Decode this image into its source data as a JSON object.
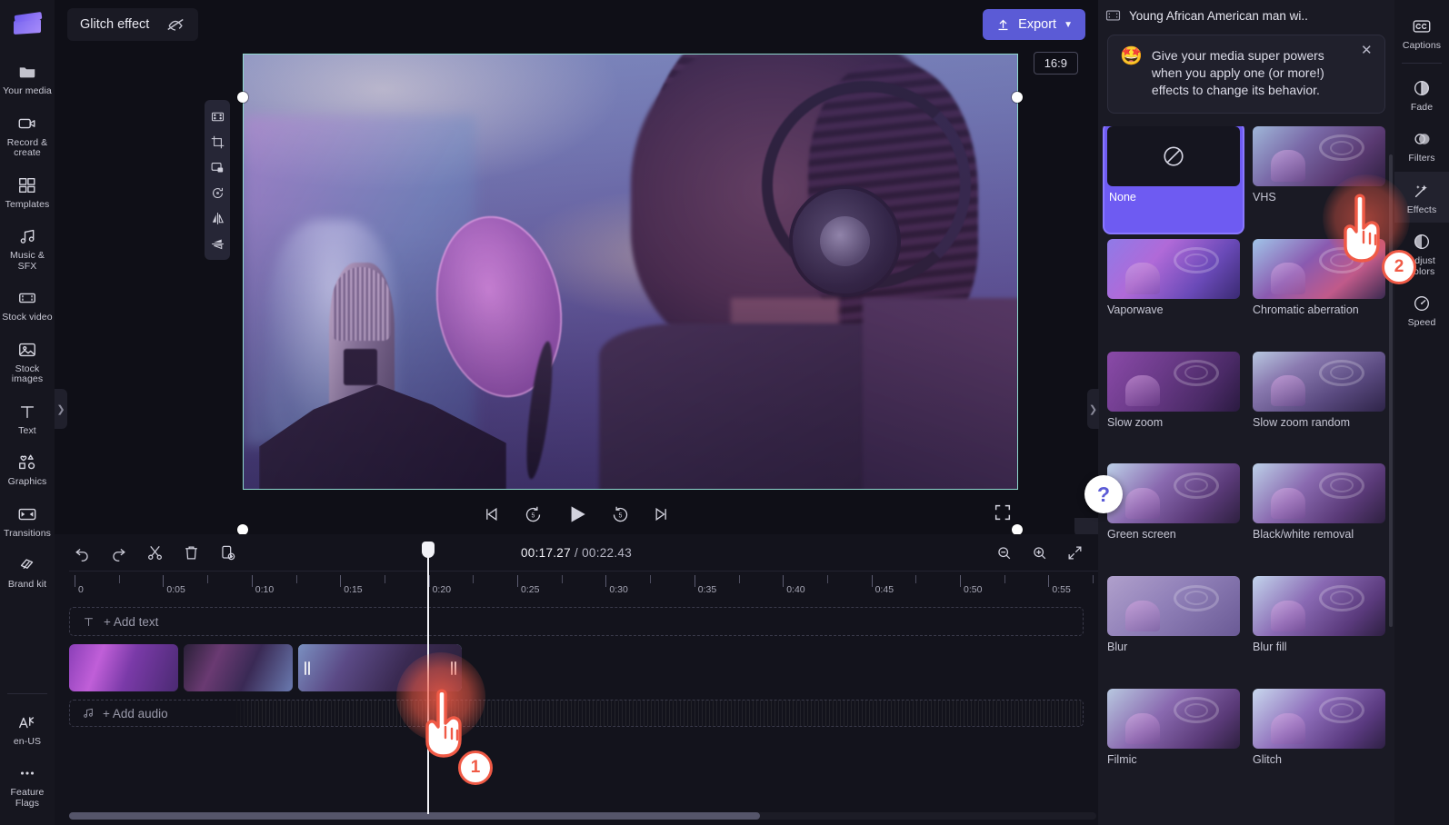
{
  "app": {
    "project_name": "Glitch effect",
    "export_label": "Export",
    "ratio_badge": "16:9"
  },
  "left_rail": {
    "items": [
      {
        "label": "Your media",
        "icon": "media-folder-icon"
      },
      {
        "label": "Record &\ncreate",
        "icon": "video-camera-icon"
      },
      {
        "label": "Templates",
        "icon": "templates-icon"
      },
      {
        "label": "Music & SFX",
        "icon": "music-note-icon"
      },
      {
        "label": "Stock video",
        "icon": "film-strip-icon"
      },
      {
        "label": "Stock\nimages",
        "icon": "image-icon"
      },
      {
        "label": "Text",
        "icon": "text-t-icon"
      },
      {
        "label": "Graphics",
        "icon": "shapes-icon"
      },
      {
        "label": "Transitions",
        "icon": "transitions-icon"
      },
      {
        "label": "Brand kit",
        "icon": "brand-kit-icon"
      }
    ],
    "bottom_items": [
      {
        "label": "en-US",
        "icon": "language-icon"
      },
      {
        "label": "Feature\nFlags",
        "icon": "ellipsis-icon"
      }
    ]
  },
  "stage_tools": [
    {
      "name": "fit-to-frame-icon"
    },
    {
      "name": "crop-icon"
    },
    {
      "name": "picture-in-picture-icon"
    },
    {
      "name": "rotate-icon"
    },
    {
      "name": "flip-horizontal-icon"
    },
    {
      "name": "flip-vertical-icon"
    }
  ],
  "playback": {
    "buttons": [
      {
        "name": "skip-to-start-button",
        "icon": "skip-start-icon"
      },
      {
        "name": "rewind-5-button",
        "icon": "rewind-5-icon"
      },
      {
        "name": "play-button",
        "icon": "play-icon"
      },
      {
        "name": "forward-5-button",
        "icon": "forward-5-icon"
      },
      {
        "name": "skip-to-end-button",
        "icon": "skip-end-icon"
      }
    ],
    "fullscreen": "fullscreen-icon",
    "help_glyph": "?"
  },
  "timeline": {
    "current_time": "00:17.27",
    "separator": " / ",
    "total_time": "00:22.43",
    "tools": [
      {
        "name": "undo-button",
        "icon": "undo-icon"
      },
      {
        "name": "redo-button",
        "icon": "redo-icon"
      },
      {
        "name": "split-button",
        "icon": "scissors-icon"
      },
      {
        "name": "delete-button",
        "icon": "trash-icon"
      },
      {
        "name": "duplicate-button",
        "icon": "duplicate-icon"
      }
    ],
    "right_tools": [
      {
        "name": "zoom-out-button",
        "icon": "zoom-out-icon"
      },
      {
        "name": "zoom-in-button",
        "icon": "zoom-in-icon"
      },
      {
        "name": "fit-timeline-button",
        "icon": "fit-icon"
      }
    ],
    "ruler_labels": [
      "0",
      "0:05",
      "0:10",
      "0:15",
      "0:20",
      "0:25",
      "0:30",
      "0:35",
      "0:40",
      "0:45",
      "0:50",
      "0:55"
    ],
    "add_text_label": "+ Add text",
    "add_audio_label": "+ Add audio",
    "clips": [
      {
        "name": "clip-1",
        "selected": false
      },
      {
        "name": "clip-2",
        "selected": false
      },
      {
        "name": "clip-3",
        "selected": true
      }
    ]
  },
  "effects_panel": {
    "header_title": "Young African American man wi..",
    "tip": {
      "emoji": "🤩",
      "text": "Give your media super powers when you apply one (or more!) effects to change its behavior.",
      "close": "✕"
    },
    "effects": [
      {
        "label": "None",
        "active": true
      },
      {
        "label": "VHS",
        "active": false
      },
      {
        "label": "Vaporwave",
        "active": false
      },
      {
        "label": "Chromatic aberration",
        "active": false
      },
      {
        "label": "Slow zoom",
        "active": false
      },
      {
        "label": "Slow zoom random",
        "active": false
      },
      {
        "label": "Green screen",
        "active": false
      },
      {
        "label": "Black/white removal",
        "active": false
      },
      {
        "label": "Blur",
        "active": false
      },
      {
        "label": "Blur fill",
        "active": false
      },
      {
        "label": "Filmic",
        "active": false
      },
      {
        "label": "Glitch",
        "active": false
      }
    ]
  },
  "right_rail": {
    "top": [
      {
        "label": "Captions",
        "icon": "closed-caption-icon"
      }
    ],
    "items": [
      {
        "label": "Fade",
        "icon": "fade-icon",
        "selected": false
      },
      {
        "label": "Filters",
        "icon": "filters-icon",
        "selected": false
      },
      {
        "label": "Effects",
        "icon": "magic-wand-icon",
        "selected": true
      },
      {
        "label": "Adjust\ncolors",
        "icon": "adjust-colors-icon",
        "selected": false
      },
      {
        "label": "Speed",
        "icon": "speedometer-icon",
        "selected": false
      }
    ]
  },
  "annotations": {
    "step1": "1",
    "step2": "2"
  },
  "colors": {
    "accent": "#5b5bd6",
    "selection": "#7fd8c7",
    "annotation": "#f05a46",
    "panel_bg": "#1a1a24",
    "rail_bg": "#16161f"
  }
}
